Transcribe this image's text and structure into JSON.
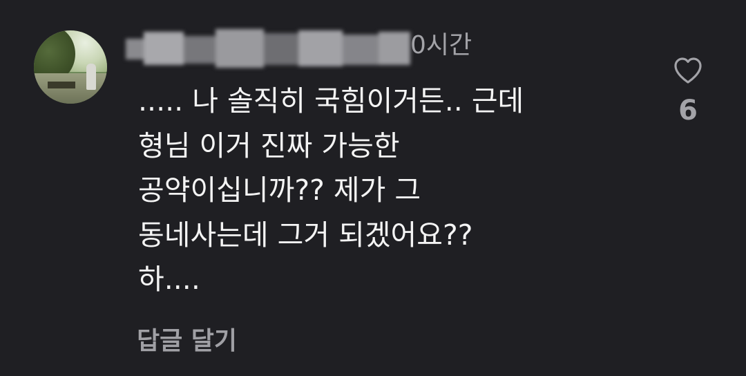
{
  "comment": {
    "time_ago": "0시간",
    "body_lines": [
      "..... 나 솔직히 국힘이거든.. 근데",
      "형님 이거 진짜 가능한",
      "공약이십니까?? 제가 그",
      "동네사는데 그거 되겠어요??",
      "하...."
    ],
    "reply_label": "답글 달기",
    "like_icon": "heart-outline-icon",
    "like_count": "6"
  },
  "colors": {
    "background": "#1f1f23",
    "primary_text": "#f4f4f4",
    "secondary_text": "#a3a3a8"
  }
}
